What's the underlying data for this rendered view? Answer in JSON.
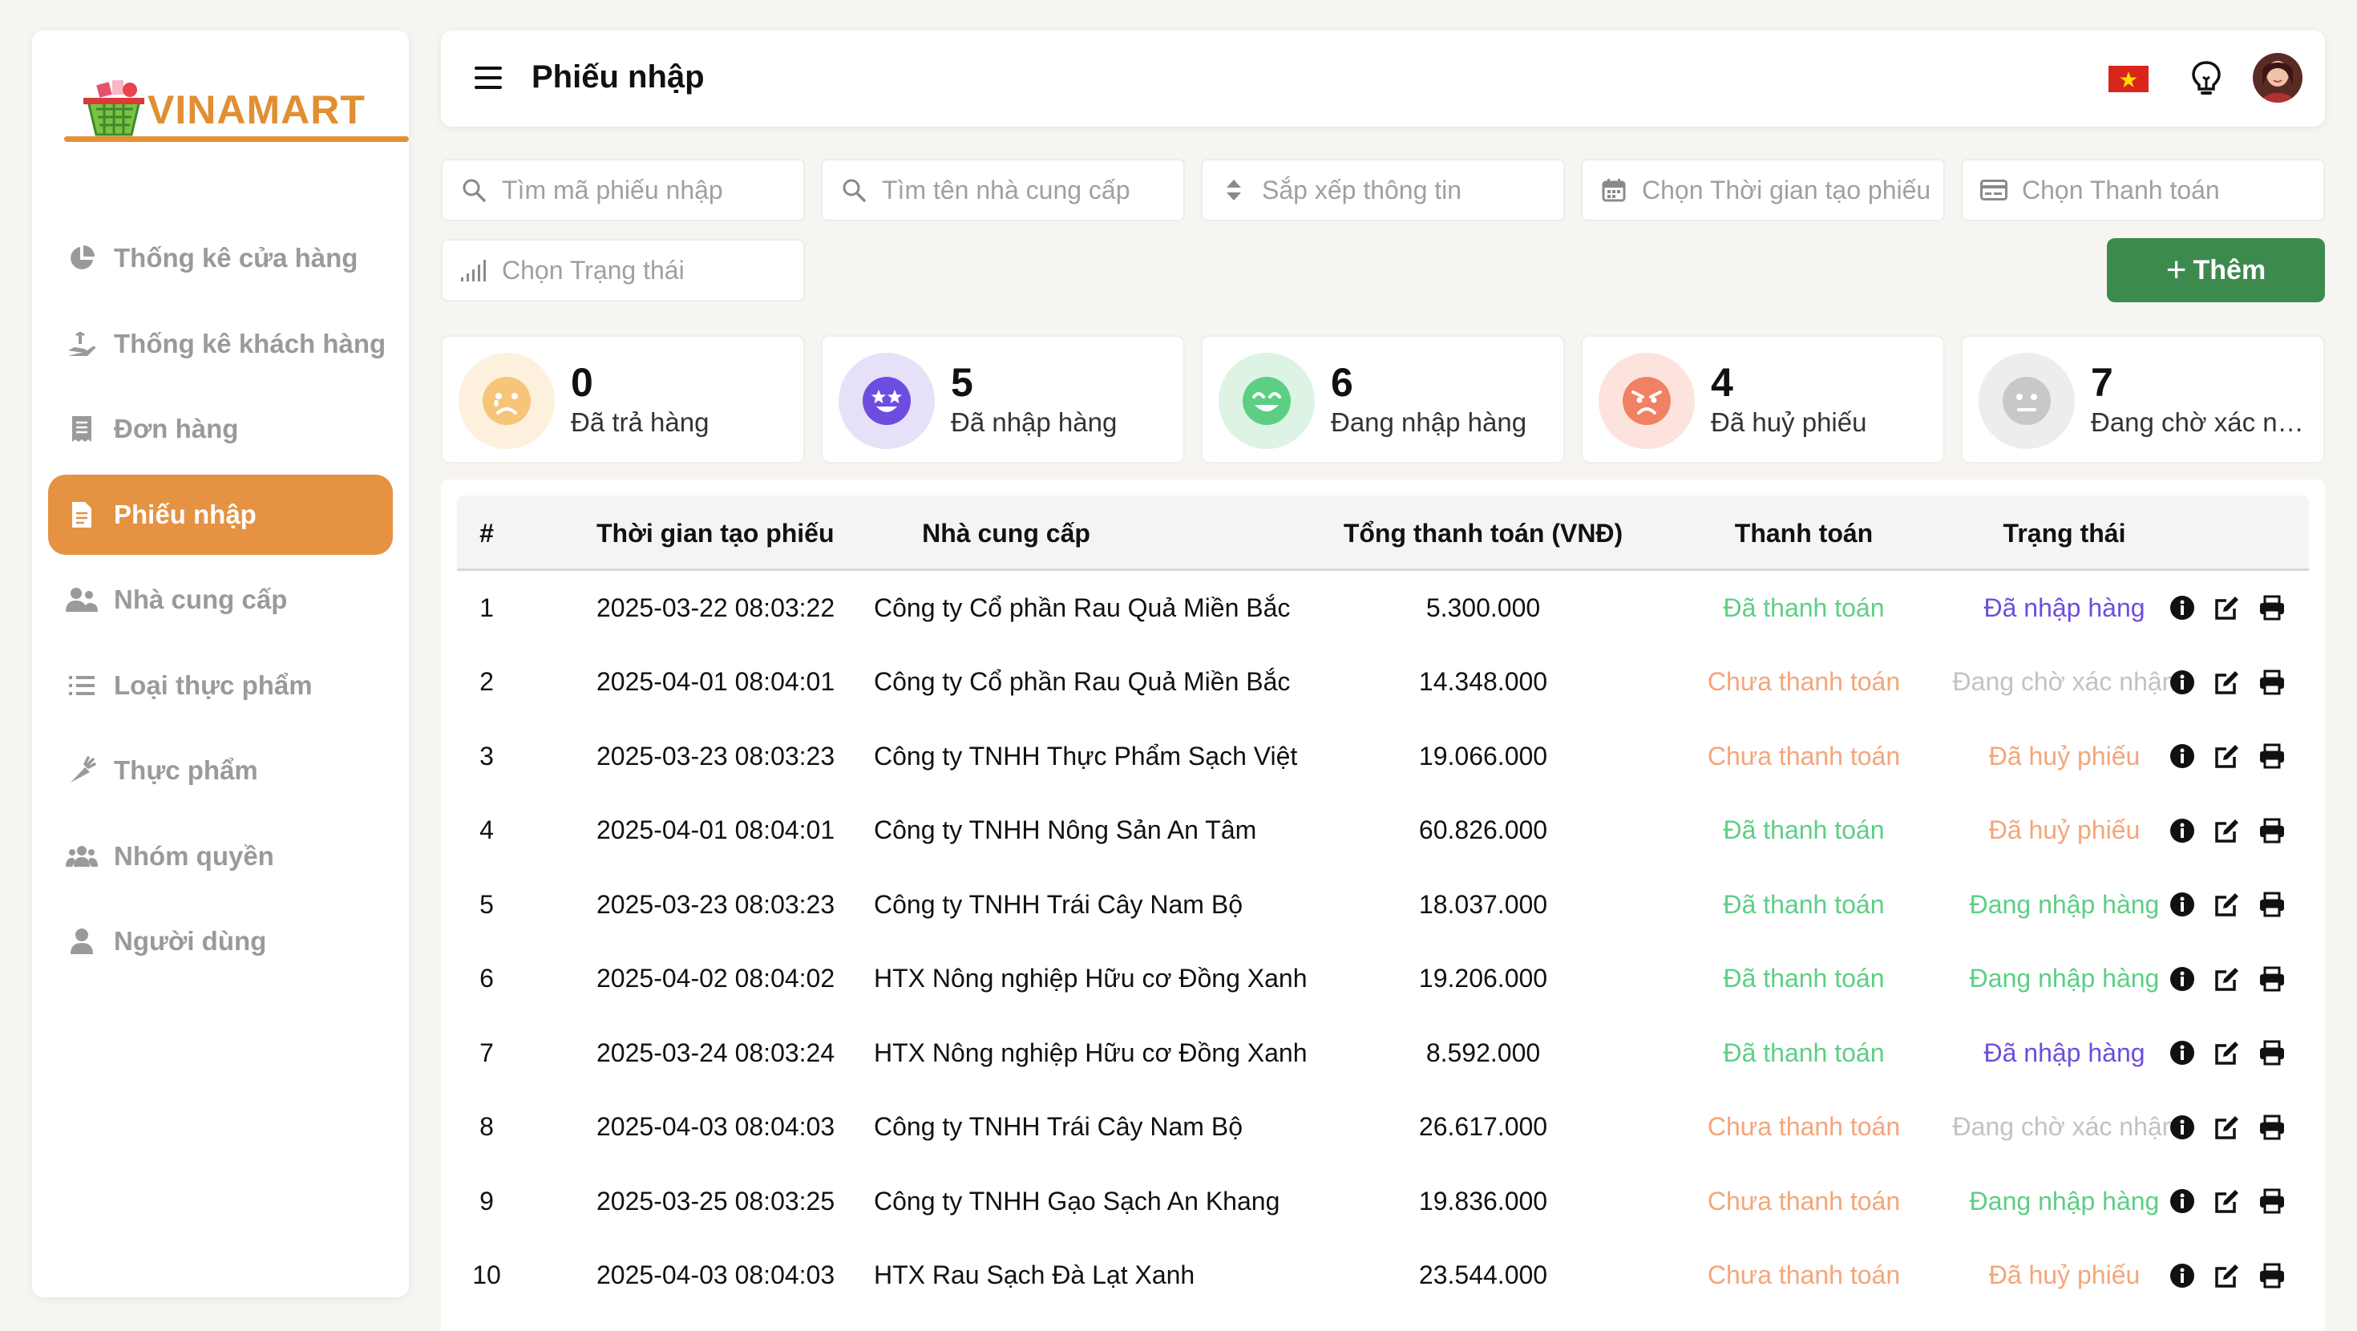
{
  "brand": {
    "name": "VINAMART",
    "accent": "#e59242",
    "green": "#3d8a4f"
  },
  "sidebar": {
    "items": [
      {
        "label": "Thống kê cửa hàng",
        "icon": "pie-chart-icon",
        "active": false
      },
      {
        "label": "Thống kê khách hàng",
        "icon": "hand-holding-icon",
        "active": false
      },
      {
        "label": "Đơn hàng",
        "icon": "receipt-icon",
        "active": false
      },
      {
        "label": "Phiếu nhập",
        "icon": "document-icon",
        "active": true
      },
      {
        "label": "Nhà cung cấp",
        "icon": "user-group-icon",
        "active": false
      },
      {
        "label": "Loại thực phẩm",
        "icon": "list-icon",
        "active": false
      },
      {
        "label": "Thực phẩm",
        "icon": "carrot-icon",
        "active": false
      },
      {
        "label": "Nhóm quyền",
        "icon": "users-icon",
        "active": false
      },
      {
        "label": "Người dùng",
        "icon": "user-icon",
        "active": false
      }
    ]
  },
  "header": {
    "title": "Phiếu nhập",
    "language_icon": "vietnam-flag-icon",
    "tips_icon": "lightbulb-icon"
  },
  "filters": {
    "search_code": "Tìm mã phiếu nhập",
    "search_supplier": "Tìm tên nhà cung cấp",
    "sort": "Sắp xếp thông tin",
    "date": "Chọn Thời gian tạo phiếu",
    "payment": "Chọn Thanh toán",
    "status": "Chọn Trạng thái",
    "add_label": "Thêm"
  },
  "stats": [
    {
      "value": "0",
      "label": "Đã trả hàng",
      "face": "sad-face-icon",
      "bg": "#fdf0dd",
      "color": "#f6c579"
    },
    {
      "value": "5",
      "label": "Đã nhập hàng",
      "face": "star-eyes-face-icon",
      "bg": "#e6e1f8",
      "color": "#6d4de0"
    },
    {
      "value": "6",
      "label": "Đang nhập hàng",
      "face": "smile-face-icon",
      "bg": "#ddf3e4",
      "color": "#5ccf85"
    },
    {
      "value": "4",
      "label": "Đã huỷ phiếu",
      "face": "angry-face-icon",
      "bg": "#fde3dd",
      "color": "#f08163"
    },
    {
      "value": "7",
      "label": "Đang chờ xác nhận",
      "face": "neutral-face-icon",
      "bg": "#ededed",
      "color": "#c8c8c8"
    }
  ],
  "table": {
    "headers": [
      "#",
      "Thời gian tạo phiếu",
      "Nhà cung cấp",
      "Tổng thanh toán (VNĐ)",
      "Thanh toán",
      "Trạng thái"
    ],
    "payment_colors": {
      "Đã thanh toán": "#5ccf85",
      "Chưa thanh toán": "#f4a57a"
    },
    "status_colors": {
      "Đã nhập hàng": "#6d4de0",
      "Đang chờ xác nhận": "#c2c2c2",
      "Đã huỷ phiếu": "#f4a57a",
      "Đang nhập hàng": "#5ccf85"
    },
    "rows": [
      {
        "id": "1",
        "time": "2025-03-22 08:03:22",
        "supplier": "Công ty Cổ phần Rau Quả Miền Bắc",
        "total": "5.300.000",
        "payment": "Đã thanh toán",
        "status": "Đã nhập hàng"
      },
      {
        "id": "2",
        "time": "2025-04-01 08:04:01",
        "supplier": "Công ty Cổ phần Rau Quả Miền Bắc",
        "total": "14.348.000",
        "payment": "Chưa thanh toán",
        "status": "Đang chờ xác nhận"
      },
      {
        "id": "3",
        "time": "2025-03-23 08:03:23",
        "supplier": "Công ty TNHH Thực Phẩm Sạch Việt",
        "total": "19.066.000",
        "payment": "Chưa thanh toán",
        "status": "Đã huỷ phiếu"
      },
      {
        "id": "4",
        "time": "2025-04-01 08:04:01",
        "supplier": "Công ty TNHH Nông Sản An Tâm",
        "total": "60.826.000",
        "payment": "Đã thanh toán",
        "status": "Đã huỷ phiếu"
      },
      {
        "id": "5",
        "time": "2025-03-23 08:03:23",
        "supplier": "Công ty TNHH Trái Cây Nam Bộ",
        "total": "18.037.000",
        "payment": "Đã thanh toán",
        "status": "Đang nhập hàng"
      },
      {
        "id": "6",
        "time": "2025-04-02 08:04:02",
        "supplier": "HTX Nông nghiệp Hữu cơ Đồng Xanh",
        "total": "19.206.000",
        "payment": "Đã thanh toán",
        "status": "Đang nhập hàng"
      },
      {
        "id": "7",
        "time": "2025-03-24 08:03:24",
        "supplier": "HTX Nông nghiệp Hữu cơ Đồng Xanh",
        "total": "8.592.000",
        "payment": "Đã thanh toán",
        "status": "Đã nhập hàng"
      },
      {
        "id": "8",
        "time": "2025-04-03 08:04:03",
        "supplier": "Công ty TNHH Trái Cây Nam Bộ",
        "total": "26.617.000",
        "payment": "Chưa thanh toán",
        "status": "Đang chờ xác nhận"
      },
      {
        "id": "9",
        "time": "2025-03-25 08:03:25",
        "supplier": "Công ty TNHH Gạo Sạch An Khang",
        "total": "19.836.000",
        "payment": "Chưa thanh toán",
        "status": "Đang nhập hàng"
      },
      {
        "id": "10",
        "time": "2025-04-03 08:04:03",
        "supplier": "HTX Rau Sạch Đà Lạt Xanh",
        "total": "23.544.000",
        "payment": "Chưa thanh toán",
        "status": "Đã huỷ phiếu"
      }
    ]
  }
}
